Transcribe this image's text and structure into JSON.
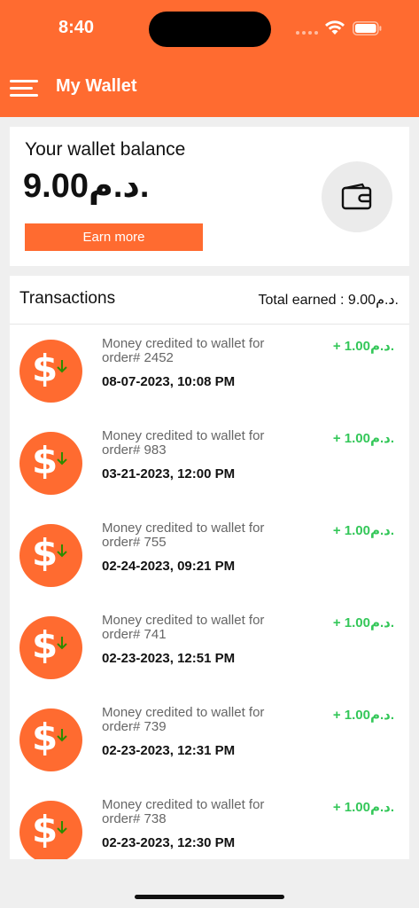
{
  "status_bar": {
    "time": "8:40"
  },
  "app_bar": {
    "title": "My Wallet"
  },
  "balance": {
    "label": "Your wallet balance",
    "amount": "9.00د.م.",
    "earn_button": "Earn more"
  },
  "transactions": {
    "title": "Transactions",
    "total_earned": "Total earned : 9.00د.م.",
    "items": [
      {
        "description": "Money credited to wallet for order# 2452",
        "date": "08-07-2023, 10:08 PM",
        "amount": "+ 1.00د.م."
      },
      {
        "description": "Money credited to wallet for order# 983",
        "date": "03-21-2023, 12:00 PM",
        "amount": "+ 1.00د.م."
      },
      {
        "description": "Money credited to wallet for order# 755",
        "date": "02-24-2023, 09:21 PM",
        "amount": "+ 1.00د.م."
      },
      {
        "description": "Money credited to wallet for order# 741",
        "date": "02-23-2023, 12:51 PM",
        "amount": "+ 1.00د.م."
      },
      {
        "description": "Money credited to wallet for order# 739",
        "date": "02-23-2023, 12:31 PM",
        "amount": "+ 1.00د.م."
      },
      {
        "description": "Money credited to wallet for order# 738",
        "date": "02-23-2023, 12:30 PM",
        "amount": "+ 1.00د.م."
      }
    ]
  },
  "colors": {
    "brand": "#ff6b30",
    "credit": "#34c759",
    "arrow": "#2e8b00"
  },
  "icons": {
    "menu": "hamburger-menu-icon",
    "wallet": "wallet-icon",
    "transaction": "dollar-credit-icon"
  }
}
